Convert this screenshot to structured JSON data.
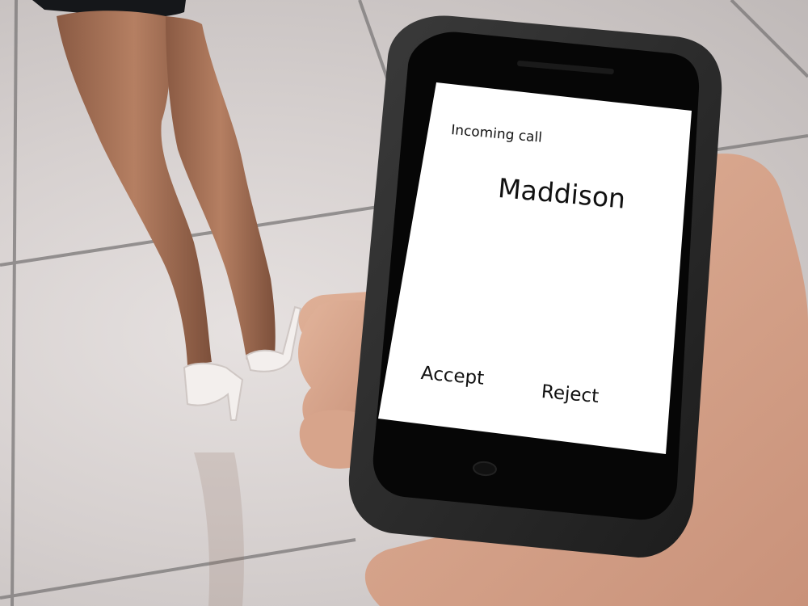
{
  "call_screen": {
    "status_label": "Incoming call",
    "caller_name": "Maddison",
    "accept_label": "Accept",
    "reject_label": "Reject"
  },
  "colors": {
    "screen_background": "#ffffff",
    "phone_body": "#2a2a2a",
    "bezel": "#050505",
    "text": "#111111",
    "floor": "#d6d0cf",
    "skin": "#d9a98c"
  },
  "icons": {
    "home_button": "home-button-icon",
    "earpiece": "earpiece-icon"
  }
}
